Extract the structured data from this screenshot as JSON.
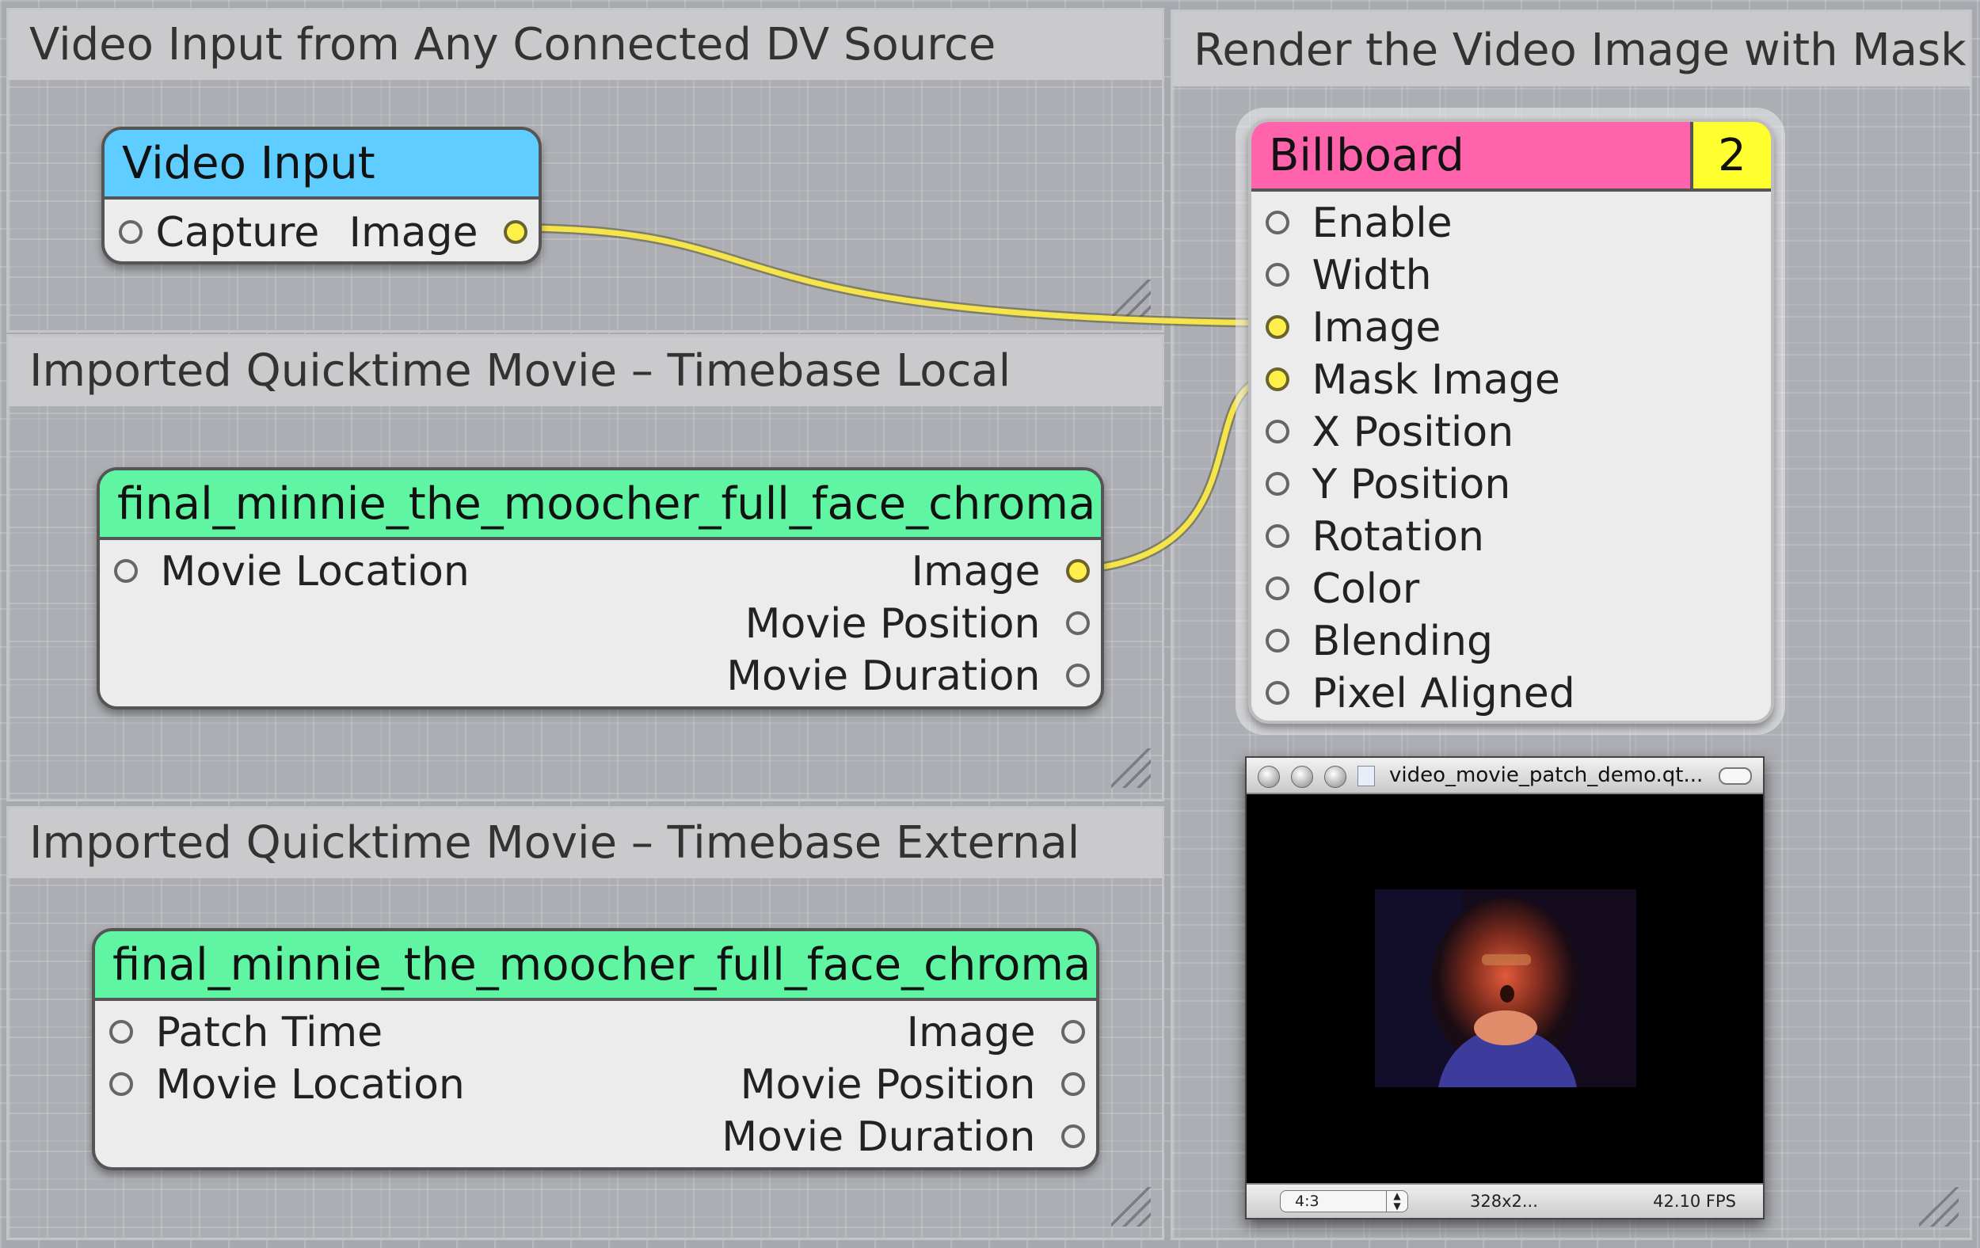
{
  "colors": {
    "wire": "#f5e54a",
    "video_input_title": "#5fcdff",
    "movie_title": "#5ff5a3",
    "billboard_title": "#ff63ac",
    "billboard_index": "#ffff30",
    "port_filled": "#ffef4a"
  },
  "groups": {
    "video_input": {
      "title": "Video Input from Any Connected DV Source"
    },
    "timebase_local": {
      "title": "Imported Quicktime Movie – Timebase Local"
    },
    "timebase_external": {
      "title": "Imported Quicktime Movie – Timebase External"
    },
    "render": {
      "title": "Render the Video Image with Mask"
    }
  },
  "patches": {
    "video_input": {
      "title": "Video Input",
      "inputs": [
        "Capture"
      ],
      "outputs": [
        "Image"
      ]
    },
    "movie_local": {
      "title": "final_minnie_the_moocher_full_face_chroma",
      "inputs": [
        "Movie Location"
      ],
      "outputs": [
        "Image",
        "Movie Position",
        "Movie Duration"
      ]
    },
    "movie_external": {
      "title": "final_minnie_the_moocher_full_face_chroma",
      "inputs": [
        "Patch Time",
        "Movie Location"
      ],
      "outputs": [
        "Image",
        "Movie Position",
        "Movie Duration"
      ]
    },
    "billboard": {
      "title": "Billboard",
      "index": "2",
      "inputs": [
        "Enable",
        "Width",
        "Image",
        "Mask Image",
        "X Position",
        "Y Position",
        "Rotation",
        "Color",
        "Blending",
        "Pixel Aligned"
      ]
    }
  },
  "preview_window": {
    "title": "video_movie_patch_demo.qt...",
    "aspect_select": "4:3",
    "resolution": "328x2...",
    "fps": "42.10 FPS"
  }
}
